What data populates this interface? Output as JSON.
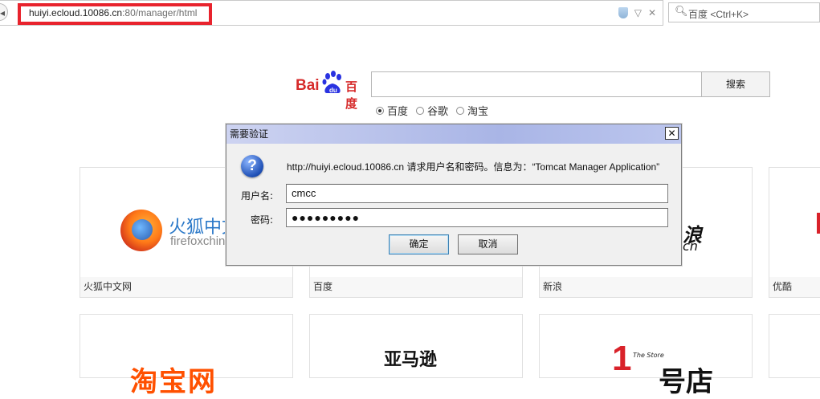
{
  "browser": {
    "url_host": "huiyi.ecloud.10086.cn",
    "url_path": ":80/manager/html",
    "search_placeholder": "百度 <Ctrl+K>",
    "highlight_color": "#e8232d"
  },
  "baidu": {
    "logo_text_a": "Bai",
    "logo_text_du": "du",
    "logo_text_b": "百度",
    "search_button": "搜索",
    "engines": [
      {
        "label": "百度",
        "selected": true
      },
      {
        "label": "谷歌",
        "selected": false
      },
      {
        "label": "淘宝",
        "selected": false
      }
    ]
  },
  "tiles": {
    "firefox": {
      "caption": "火狐中文网",
      "logo_title": "火狐中文",
      "logo_sub": "firefoxchin"
    },
    "baidu": {
      "caption": "百度"
    },
    "sina": {
      "caption": "新浪",
      "logo_title": "浪",
      "logo_sub": "cn"
    },
    "youku": {
      "caption": "优酷"
    },
    "taobao": {
      "logo": "淘宝网"
    },
    "amazon": {
      "logo": "亚马逊"
    },
    "yhd": {
      "logo_num": "1",
      "logo_store": "The Store",
      "logo_dian": "号店"
    }
  },
  "dialog": {
    "title": "需要验证",
    "close": "✕",
    "icon": "question-icon",
    "message": "http://huiyi.ecloud.10086.cn 请求用户名和密码。信息为：“Tomcat Manager Application”",
    "username_label": "用户名:",
    "username_value": "cmcc",
    "password_label": "密码:",
    "password_value": "●●●●●●●●●",
    "ok": "确定",
    "cancel": "取消"
  }
}
